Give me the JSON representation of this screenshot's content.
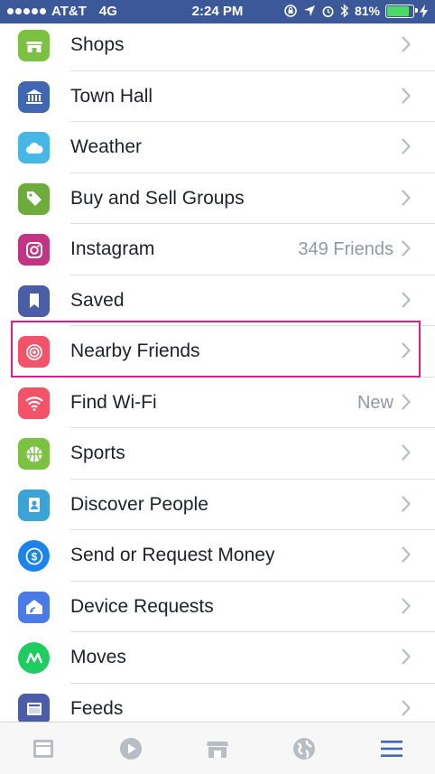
{
  "status_bar": {
    "carrier": "AT&T",
    "network": "4G",
    "time": "2:24 PM",
    "battery": "81%"
  },
  "menu": {
    "items": [
      {
        "label": "Shops",
        "meta": "",
        "icon": "shop-icon",
        "color": "#7cc242"
      },
      {
        "label": "Town Hall",
        "meta": "",
        "icon": "town-hall-icon",
        "color": "#4267b2"
      },
      {
        "label": "Weather",
        "meta": "",
        "icon": "cloud-icon",
        "color": "#47b8e6"
      },
      {
        "label": "Buy and Sell Groups",
        "meta": "",
        "icon": "price-tag-icon",
        "color": "#6dab3c"
      },
      {
        "label": "Instagram",
        "meta": "349 Friends",
        "icon": "instagram-icon",
        "color": "#c13584"
      },
      {
        "label": "Saved",
        "meta": "",
        "icon": "bookmark-icon",
        "color": "#4a5da6"
      },
      {
        "label": "Nearby Friends",
        "meta": "",
        "icon": "nearby-target-icon",
        "color": "#f35369"
      },
      {
        "label": "Find Wi-Fi",
        "meta": "New",
        "icon": "wifi-icon",
        "color": "#f35369"
      },
      {
        "label": "Sports",
        "meta": "",
        "icon": "sports-ball-icon",
        "color": "#7cc242"
      },
      {
        "label": "Discover People",
        "meta": "",
        "icon": "people-card-icon",
        "color": "#3ba3d6"
      },
      {
        "label": "Send or Request Money",
        "meta": "",
        "icon": "dollar-icon",
        "color": "#1b84ea"
      },
      {
        "label": "Device Requests",
        "meta": "",
        "icon": "device-house-icon",
        "color": "#4a7ae6"
      },
      {
        "label": "Moves",
        "meta": "",
        "icon": "moves-icon",
        "color": "#1fcc60"
      },
      {
        "label": "Feeds",
        "meta": "",
        "icon": "feeds-icon",
        "color": "#4a5da6"
      }
    ]
  },
  "tabbar": {
    "tabs": [
      {
        "icon": "news-feed-icon",
        "active": false
      },
      {
        "icon": "video-play-icon",
        "active": false
      },
      {
        "icon": "marketplace-icon",
        "active": false
      },
      {
        "icon": "globe-notifications-icon",
        "active": false
      },
      {
        "icon": "menu-icon",
        "active": true
      }
    ],
    "active_color": "#4267b2",
    "inactive_color": "#b8bcc3"
  },
  "highlight_color": "#d61f8c"
}
